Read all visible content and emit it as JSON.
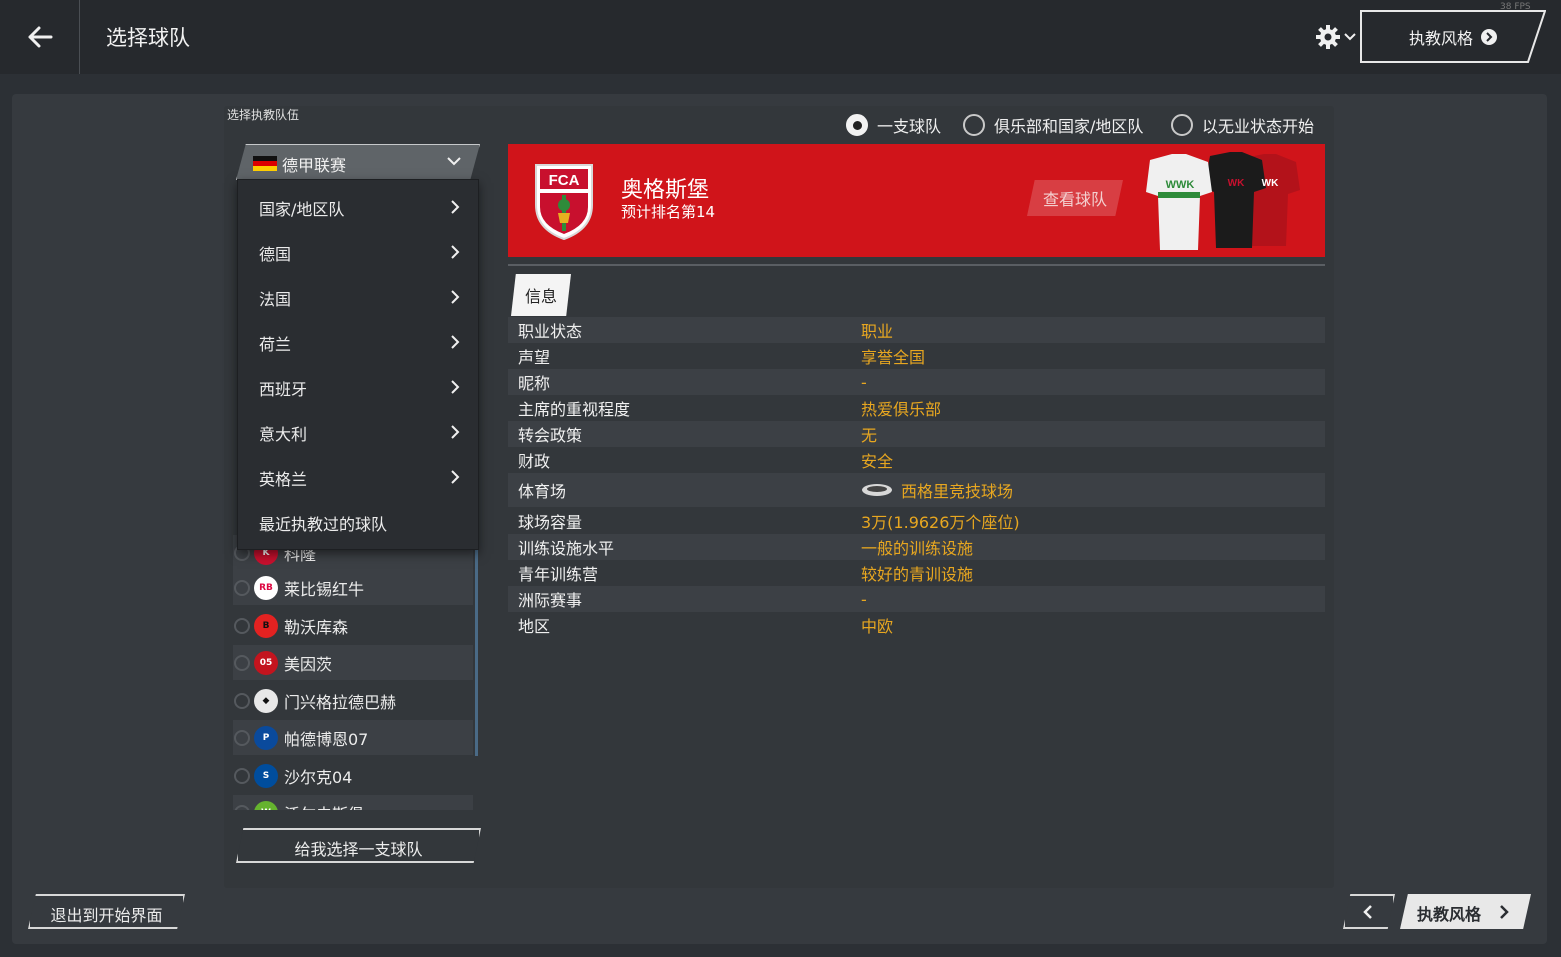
{
  "header": {
    "title": "选择球队",
    "coaching_style_label": "执教风格",
    "fps": "38 FPS"
  },
  "left": {
    "select_label": "选择执教队伍",
    "league": "德甲联赛",
    "menu": [
      {
        "label": "国家/地区队",
        "has_arrow": true
      },
      {
        "label": "德国",
        "has_arrow": true
      },
      {
        "label": "法国",
        "has_arrow": true
      },
      {
        "label": "荷兰",
        "has_arrow": true
      },
      {
        "label": "西班牙",
        "has_arrow": true
      },
      {
        "label": "意大利",
        "has_arrow": true
      },
      {
        "label": "英格兰",
        "has_arrow": true
      },
      {
        "label": "最近执教过的球队",
        "has_arrow": false
      }
    ],
    "teams": [
      {
        "name": "科隆",
        "crest_color": "#c8102e"
      },
      {
        "name": "莱比锡红牛",
        "crest_color": "#dd0741"
      },
      {
        "name": "勒沃库森",
        "crest_color": "#e32221"
      },
      {
        "name": "美因茨",
        "crest_color": "#c3141e"
      },
      {
        "name": "门兴格拉德巴赫",
        "crest_color": "#1a1a1a"
      },
      {
        "name": "帕德博恩07",
        "crest_color": "#0a4a9c"
      },
      {
        "name": "沙尔克04",
        "crest_color": "#004d9d"
      },
      {
        "name": "沃尔夫斯堡",
        "crest_color": "#65b32e"
      }
    ],
    "pick_random": "给我选择一支球队"
  },
  "modes": [
    {
      "label": "一支球队",
      "selected": true
    },
    {
      "label": "俱乐部和国家/地区队",
      "selected": false
    },
    {
      "label": "以无业状态开始",
      "selected": false
    }
  ],
  "club": {
    "name": "奥格斯堡",
    "predicted": "预计排名第14",
    "view_team": "查看球队",
    "crest_text": "FCA",
    "kit_sponsor": "WWK",
    "banner_color": "#d0141a"
  },
  "info": {
    "tab": "信息",
    "rows": [
      {
        "key": "职业状态",
        "value": "职业"
      },
      {
        "key": "声望",
        "value": "享誉全国"
      },
      {
        "key": "昵称",
        "value": "-"
      },
      {
        "key": "主席的重视程度",
        "value": "热爱俱乐部"
      },
      {
        "key": "转会政策",
        "value": "无"
      },
      {
        "key": "财政",
        "value": "安全"
      },
      {
        "key": "体育场",
        "value": "西格里竞技球场",
        "icon": "stadium-icon"
      },
      {
        "key": "球场容量",
        "value": "3万(1.9626万个座位)"
      },
      {
        "key": "训练设施水平",
        "value": "一般的训练设施"
      },
      {
        "key": "青年训练营",
        "value": "较好的青训设施"
      },
      {
        "key": "洲际赛事",
        "value": "-"
      },
      {
        "key": "地区",
        "value": "中欧"
      }
    ]
  },
  "footer": {
    "exit": "退出到开始界面",
    "next": "执教风格"
  },
  "colors": {
    "accent_value": "#e8a720",
    "topbar": "#26292d",
    "panel": "#363a3f"
  }
}
